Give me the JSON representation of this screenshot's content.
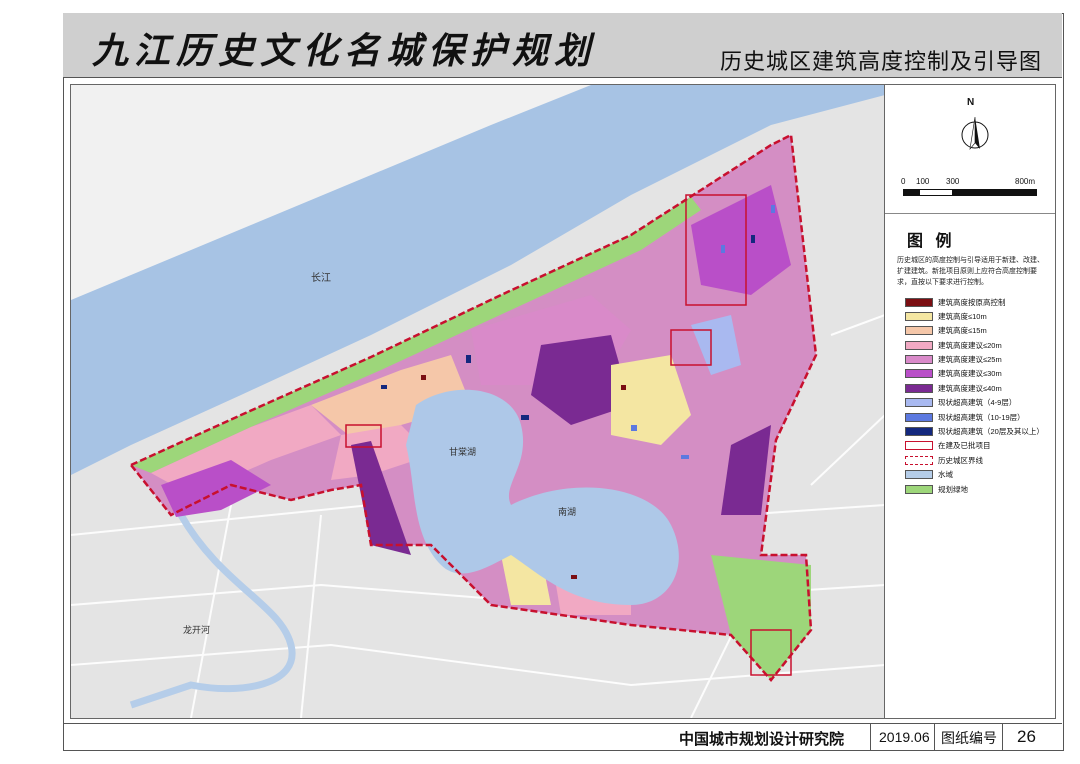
{
  "header": {
    "main_title": "九江历史文化名城保护规划",
    "sub_title": "历史城区建筑高度控制及引导图"
  },
  "map": {
    "labels": {
      "river": "长江",
      "lake_north": "甘棠湖",
      "lake_south": "南湖",
      "canal": "龙开河"
    },
    "colors": {
      "river": "#a7c3e4",
      "lake": "#aec8e8",
      "base_gray": "#e6e6e6",
      "boundary": "#c8102e"
    }
  },
  "legend": {
    "north_label": "N",
    "scale_labels": [
      "0",
      "100",
      "300",
      "800m"
    ],
    "title": "图 例",
    "note": "历史城区的高度控制与引导适用于新建、改建、扩建建筑。新批项目原则上应符合高度控制要求，直按以下要求进行控制。",
    "items": [
      {
        "label": "建筑高度按原高控制",
        "color": "#7b0e12",
        "style": "fill"
      },
      {
        "label": "建筑高度≤10m",
        "color": "#f4e6a2",
        "style": "fill"
      },
      {
        "label": "建筑高度≤15m",
        "color": "#f5c7a9",
        "style": "fill"
      },
      {
        "label": "建筑高度建议≤20m",
        "color": "#f1a9c3",
        "style": "fill"
      },
      {
        "label": "建筑高度建议≤25m",
        "color": "#d98ac9",
        "style": "fill"
      },
      {
        "label": "建筑高度建议≤30m",
        "color": "#b94fc8",
        "style": "fill"
      },
      {
        "label": "建筑高度建议≤40m",
        "color": "#7a2a92",
        "style": "fill"
      },
      {
        "label": "现状超高建筑（4-9层）",
        "color": "#a9b9f0",
        "style": "fill"
      },
      {
        "label": "现状超高建筑（10-19层）",
        "color": "#5c79e0",
        "style": "fill"
      },
      {
        "label": "现状超高建筑（20层及其以上）",
        "color": "#14287e",
        "style": "fill"
      },
      {
        "label": "在建及已批项目",
        "color": "#c8102e",
        "style": "outline"
      },
      {
        "label": "历史城区界线",
        "color": "#c8102e",
        "style": "dashed"
      },
      {
        "label": "水域",
        "color": "#b5cde9",
        "style": "fill"
      },
      {
        "label": "规划绿地",
        "color": "#9dd67a",
        "style": "fill"
      }
    ]
  },
  "footer": {
    "organization": "中国城市规划设计研究院",
    "date": "2019.06",
    "drawing_no_label": "图纸编号",
    "drawing_no": "26"
  }
}
